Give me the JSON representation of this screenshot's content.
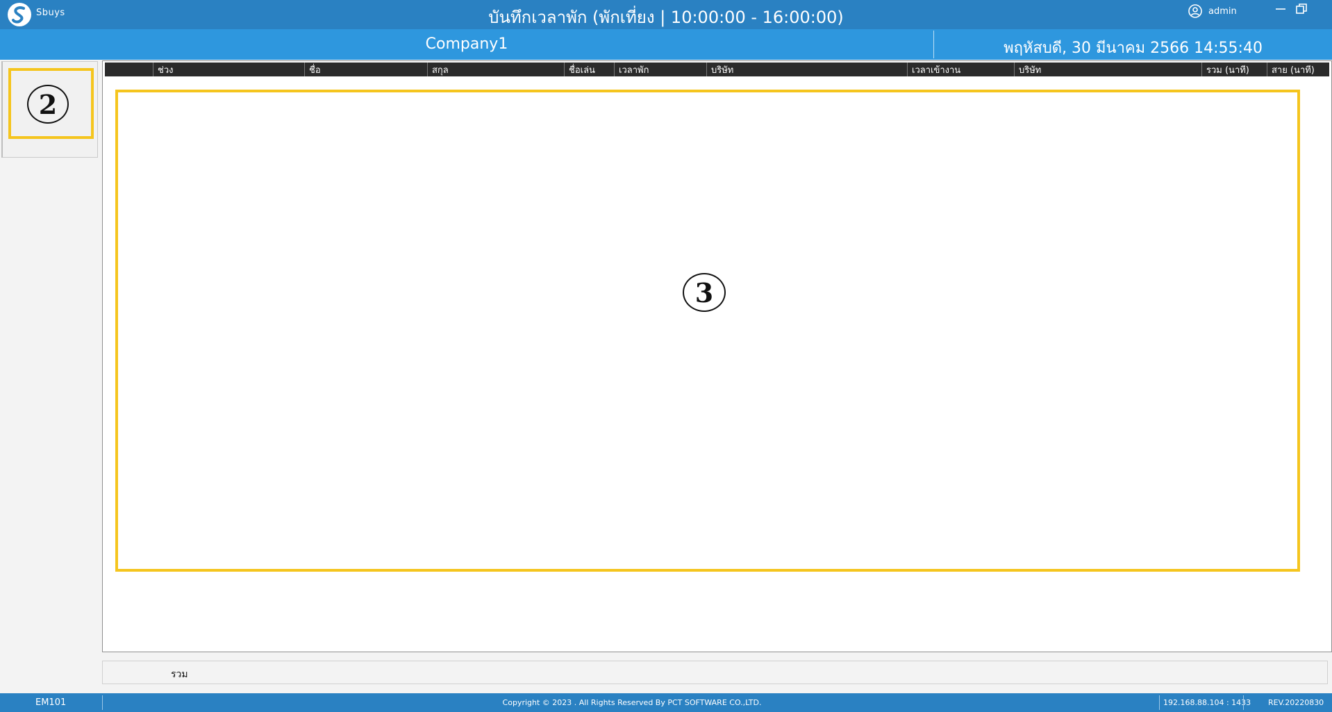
{
  "app": {
    "logo_text": "Sbuys",
    "title": "บันทึกเวลาพัก (พักเที่ยง | 10:00:00 - 16:00:00)",
    "user_name": "admin"
  },
  "header": {
    "company": "Company1",
    "datetime": "พฤหัสบดี, 30 มีนาคม 2566 14:55:40"
  },
  "grid": {
    "columns": [
      "",
      "ช่วง",
      "ชื่อ",
      "สกุล",
      "ชื่อเล่น",
      "เวลาพัก",
      "บริษัท",
      "เวลาเข้างาน",
      "บริษัท",
      "รวม (นาที)",
      "สาย (นาที)"
    ],
    "rows": []
  },
  "callouts": [
    "2",
    "3"
  ],
  "summary": {
    "label": "รวม"
  },
  "status": {
    "code": "EM101",
    "copyright": "Copyright © 2023 . All Rights Reserved By PCT SOFTWARE CO.,LTD.",
    "server": "192.168.88.104 : 1433",
    "revision": "REV.20220830"
  },
  "colors": {
    "titlebar": "#2a81c2",
    "headerbar": "#2e97de",
    "grid_header": "#2b2b2b",
    "callout": "#f5c51e"
  }
}
